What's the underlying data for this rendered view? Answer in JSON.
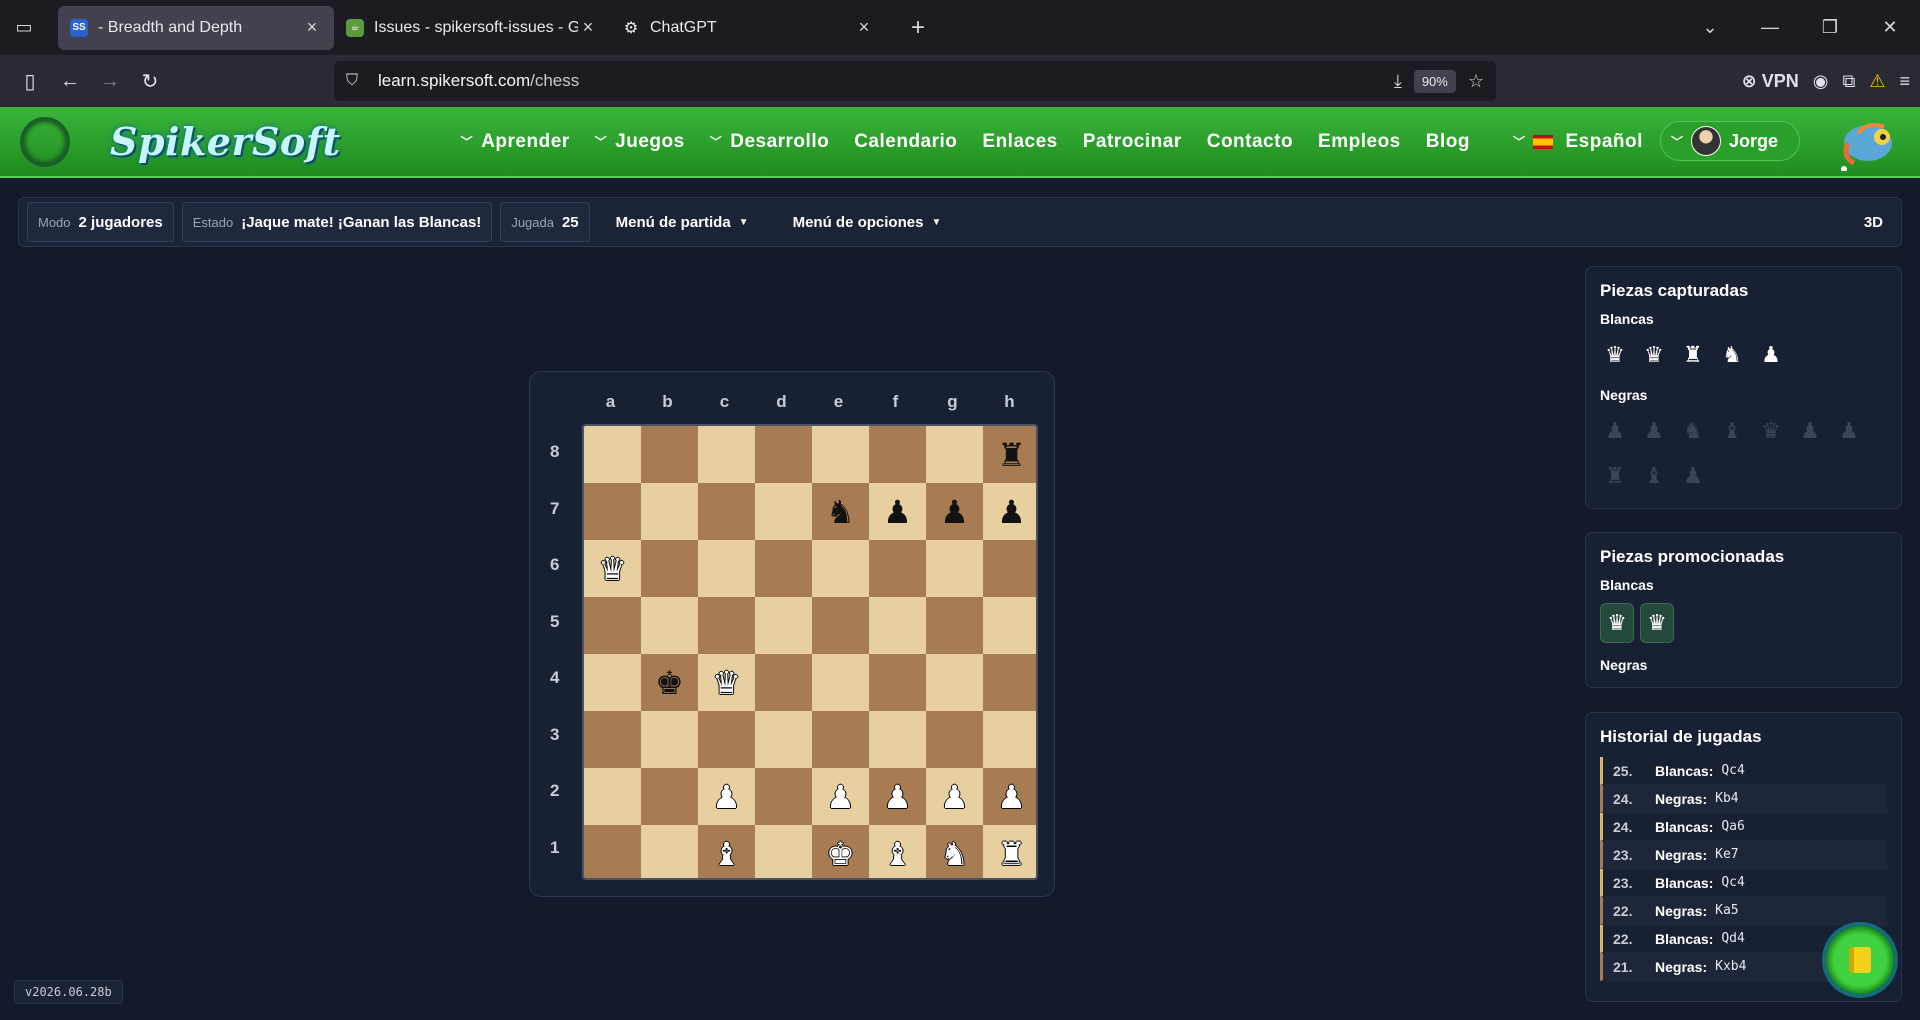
{
  "browser": {
    "tabs": [
      {
        "title": "- Breadth and Depth",
        "favicon": "SS",
        "active": true
      },
      {
        "title": "Issues - spikersoft-issues - Gitea",
        "favicon": "gitea",
        "active": false
      },
      {
        "title": "ChatGPT",
        "favicon": "chatgpt",
        "active": false
      }
    ],
    "url_domain": "learn.spikersoft.com",
    "url_path": "/chess",
    "zoom": "90%",
    "vpn_label": "VPN"
  },
  "site": {
    "brand": "SpikerSoft",
    "nav": [
      {
        "label": "Aprender",
        "dropdown": true
      },
      {
        "label": "Juegos",
        "dropdown": true
      },
      {
        "label": "Desarrollo",
        "dropdown": true
      },
      {
        "label": "Calendario",
        "dropdown": false
      },
      {
        "label": "Enlaces",
        "dropdown": false
      },
      {
        "label": "Patrocinar",
        "dropdown": false
      },
      {
        "label": "Contacto",
        "dropdown": false
      },
      {
        "label": "Empleos",
        "dropdown": false
      },
      {
        "label": "Blog",
        "dropdown": false
      }
    ],
    "language": "Español",
    "user": "Jorge"
  },
  "gamebar": {
    "mode_label": "Modo",
    "mode_value": "2 jugadores",
    "status_label": "Estado",
    "status_value": "¡Jaque mate! ¡Ganan las Blancas!",
    "move_label": "Jugada",
    "move_value": "25",
    "menu_game": "Menú de partida",
    "menu_options": "Menú de opciones",
    "view_3d": "3D"
  },
  "board": {
    "files": [
      "a",
      "b",
      "c",
      "d",
      "e",
      "f",
      "g",
      "h"
    ],
    "ranks": [
      "8",
      "7",
      "6",
      "5",
      "4",
      "3",
      "2",
      "1"
    ],
    "position": [
      [
        "",
        "",
        "",
        "",
        "",
        "",
        "",
        "br"
      ],
      [
        "",
        "",
        "",
        "",
        "bn",
        "bp",
        "bp",
        "bp"
      ],
      [
        "wq",
        "",
        "",
        "",
        "",
        "",
        "",
        ""
      ],
      [
        "",
        "",
        "",
        "",
        "",
        "",
        "",
        ""
      ],
      [
        "",
        "bk",
        "wq",
        "",
        "",
        "",
        "",
        ""
      ],
      [
        "",
        "",
        "",
        "",
        "",
        "",
        "",
        ""
      ],
      [
        "",
        "",
        "wp",
        "",
        "wp",
        "wp",
        "wp",
        "wp"
      ],
      [
        "",
        "",
        "wb",
        "",
        "wk",
        "wb",
        "wn",
        "wr"
      ]
    ]
  },
  "captured": {
    "title": "Piezas capturadas",
    "white_label": "Blancas",
    "white": [
      "q",
      "q",
      "r",
      "n",
      "p"
    ],
    "black_label": "Negras",
    "black": [
      "p",
      "p",
      "n",
      "b",
      "q",
      "p",
      "p",
      "r",
      "b",
      "p"
    ]
  },
  "promoted": {
    "title": "Piezas promocionadas",
    "white_label": "Blancas",
    "white": [
      "q",
      "q"
    ],
    "black_label": "Negras"
  },
  "history": {
    "title": "Historial de jugadas",
    "moves": [
      {
        "num": "25.",
        "side": "Blancas:",
        "move": "Qc4"
      },
      {
        "num": "24.",
        "side": "Negras:",
        "move": "Kb4"
      },
      {
        "num": "24.",
        "side": "Blancas:",
        "move": "Qa6"
      },
      {
        "num": "23.",
        "side": "Negras:",
        "move": "Ke7"
      },
      {
        "num": "23.",
        "side": "Blancas:",
        "move": "Qc4"
      },
      {
        "num": "22.",
        "side": "Negras:",
        "move": "Ka5"
      },
      {
        "num": "22.",
        "side": "Blancas:",
        "move": "Qd4"
      },
      {
        "num": "21.",
        "side": "Negras:",
        "move": "Kxb4"
      }
    ]
  },
  "version": "v2026.06.28b"
}
